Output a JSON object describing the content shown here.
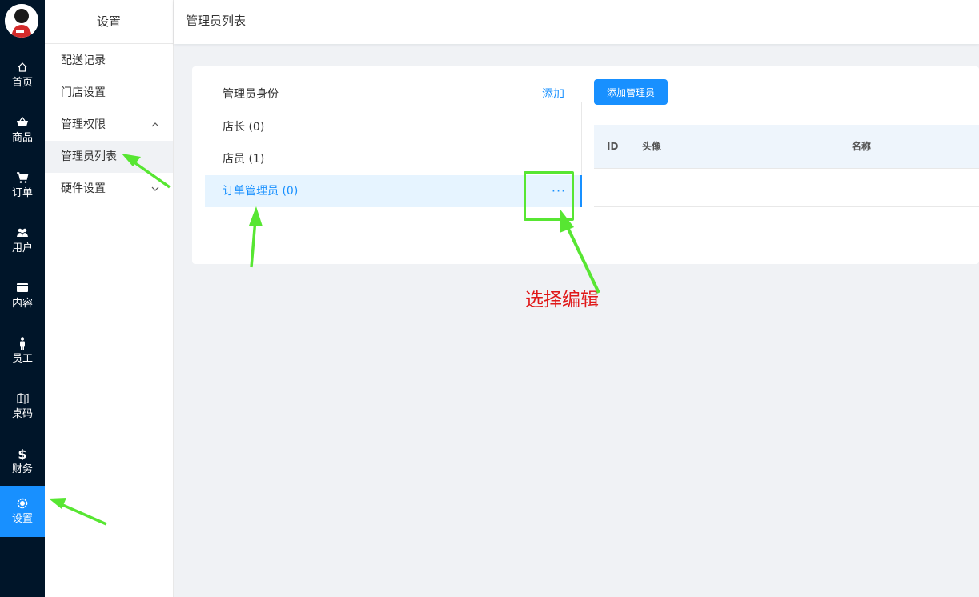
{
  "rail": {
    "items": [
      {
        "label": "首页",
        "icon": "home-icon"
      },
      {
        "label": "商品",
        "icon": "basket-icon"
      },
      {
        "label": "订单",
        "icon": "cart-icon"
      },
      {
        "label": "用户",
        "icon": "users-icon"
      },
      {
        "label": "内容",
        "icon": "folder-icon"
      },
      {
        "label": "员工",
        "icon": "person-icon"
      },
      {
        "label": "桌码",
        "icon": "map-icon"
      },
      {
        "label": "财务",
        "icon": "dollar-icon"
      },
      {
        "label": "设置",
        "icon": "settings-icon",
        "active": true
      }
    ],
    "accent": "#1890ff",
    "background": "#001529"
  },
  "sidebar": {
    "title": "设置",
    "items": [
      {
        "label": "配送记录"
      },
      {
        "label": "门店设置"
      },
      {
        "label": "管理权限",
        "expanded": true
      },
      {
        "label": "管理员列表",
        "active": true
      },
      {
        "label": "硬件设置",
        "expanded": false
      }
    ]
  },
  "header": {
    "title": "管理员列表"
  },
  "roles": {
    "heading": "管理员身份",
    "add_label": "添加",
    "items": [
      {
        "label": "店长 (0)"
      },
      {
        "label": "店员 (1)"
      },
      {
        "label": "订单管理员 (0)",
        "active": true,
        "more": "···"
      }
    ]
  },
  "admins": {
    "add_button": "添加管理员",
    "columns": [
      "ID",
      "头像",
      "名称"
    ],
    "rows": []
  },
  "annotation": {
    "text": "选择编辑",
    "color": "#e01818",
    "arrow_color": "#57e632"
  }
}
